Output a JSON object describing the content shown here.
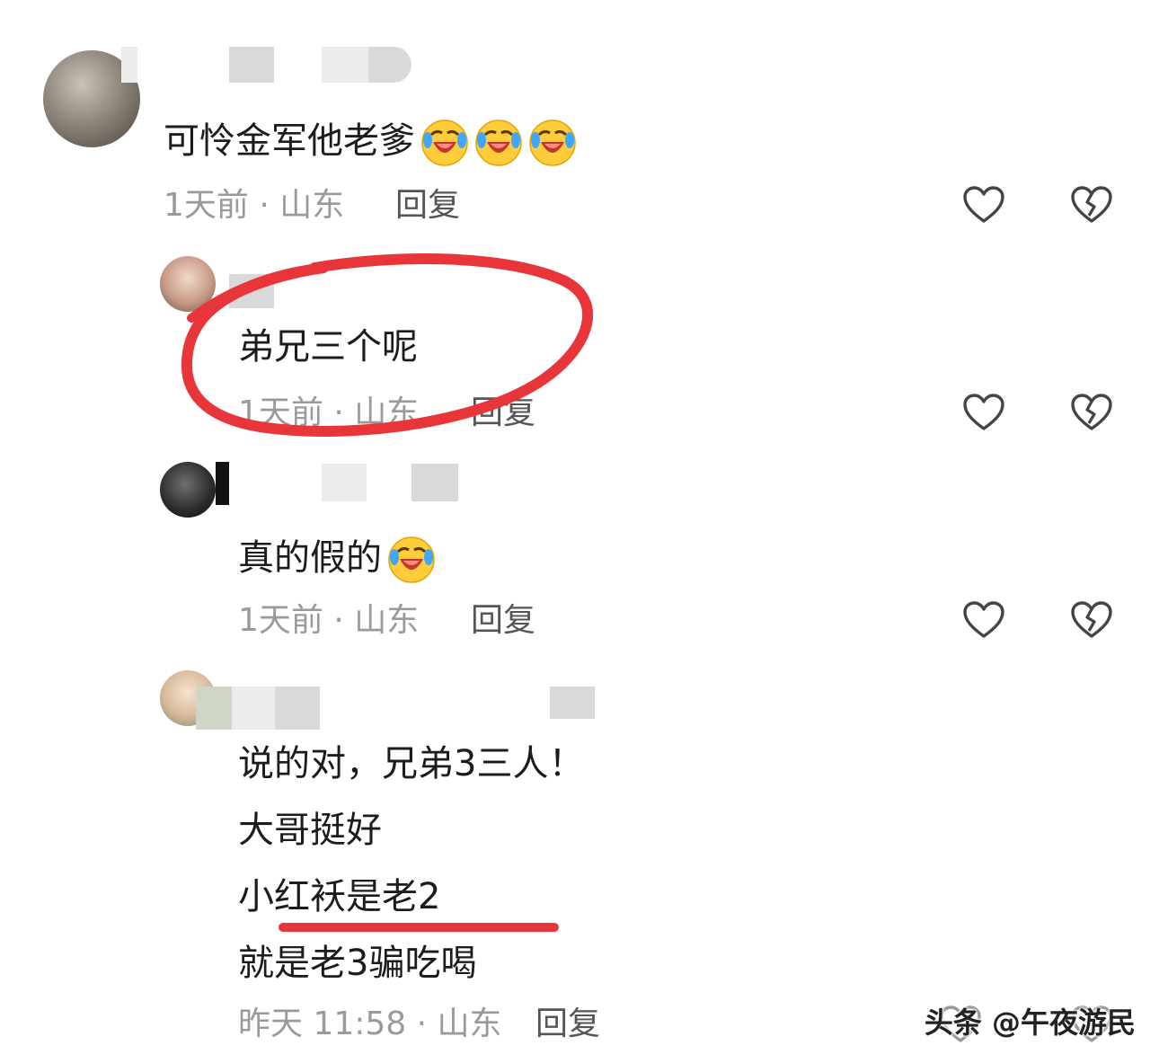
{
  "comments": [
    {
      "text": "可怜金军他老爹",
      "emoji_count": 3,
      "time": "1天前",
      "location": "山东",
      "reply_label": "回复"
    },
    {
      "text": "弟兄三个呢",
      "time": "1天前",
      "location": "山东",
      "reply_label": "回复"
    },
    {
      "text": "真的假的",
      "emoji_count": 1,
      "time": "1天前",
      "location": "山东",
      "reply_label": "回复"
    },
    {
      "lines": [
        "说的对，兄弟3三人！",
        "大哥挺好",
        "小红袄是老2",
        "就是老3骗吃喝"
      ],
      "time": "昨天 11:58",
      "location": "山东",
      "reply_label": "回复"
    }
  ],
  "separator": " · ",
  "watermark": "头条 @午夜游民",
  "annotation_color": "#e8353a",
  "icons": [
    "heart-outline-icon",
    "broken-heart-icon",
    "laugh-cry-emoji"
  ]
}
